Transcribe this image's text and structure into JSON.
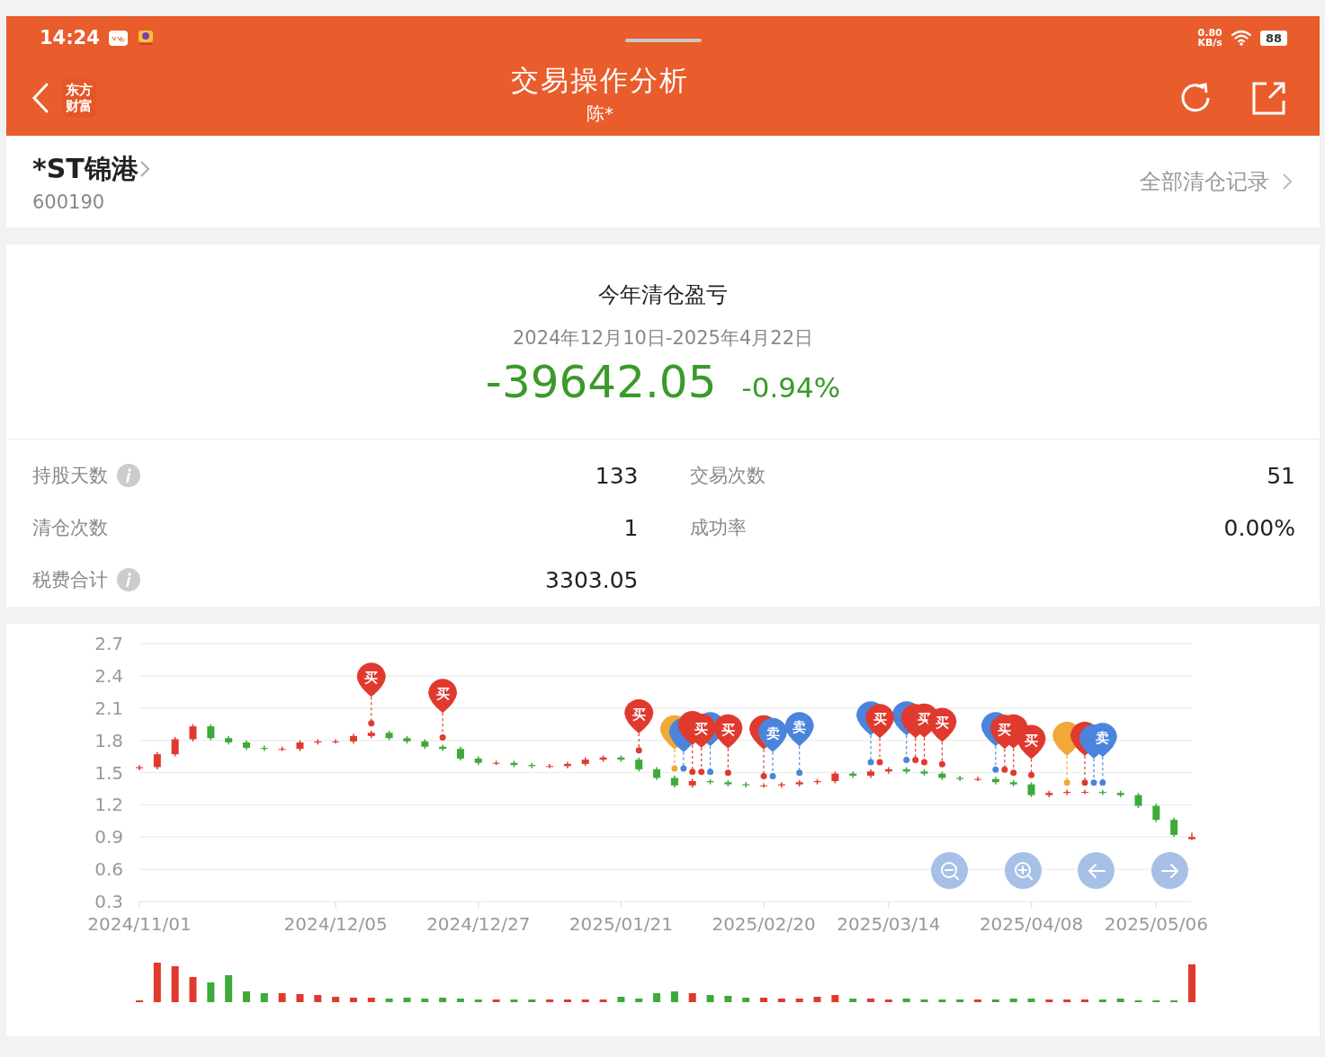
{
  "status_bar": {
    "time": "14:24",
    "network_speed": "0.80",
    "speed_unit": "KB/s",
    "battery": "88"
  },
  "header": {
    "logo": "东方财富",
    "title": "交易操作分析",
    "subtitle": "陈*"
  },
  "stock": {
    "name": "*ST锦港",
    "code": "600190",
    "link": "全部清仓记录"
  },
  "summary": {
    "title": "今年清仓盈亏",
    "period": "2024年12月10日-2025年4月22日",
    "profit": "-39642.05",
    "percent": "-0.94%"
  },
  "stats": [
    {
      "label": "持股天数",
      "value": "133",
      "info": true
    },
    {
      "label": "交易次数",
      "value": "51",
      "info": false
    },
    {
      "label": "清仓次数",
      "value": "1",
      "info": false
    },
    {
      "label": "成功率",
      "value": "0.00%",
      "info": false
    },
    {
      "label": "税费合计",
      "value": "3303.05",
      "info": true
    }
  ],
  "chart": {
    "chart_data": {
      "type": "candlestick",
      "categories": [
        "2024/11/01",
        null,
        null,
        null,
        null,
        null,
        null,
        null,
        null,
        null,
        null,
        "2024/12/05",
        null,
        null,
        null,
        null,
        null,
        null,
        null,
        "2024/12/27",
        null,
        null,
        null,
        null,
        null,
        null,
        null,
        "2025/01/21",
        null,
        null,
        null,
        null,
        null,
        null,
        null,
        "2025/02/20",
        null,
        null,
        null,
        null,
        null,
        null,
        "2025/03/14",
        null,
        null,
        null,
        null,
        null,
        null,
        null,
        "2025/04/08",
        null,
        null,
        null,
        null,
        null,
        null,
        "2025/05/06",
        null,
        null
      ],
      "ohlc": [
        [
          1.54,
          1.57,
          1.52,
          1.55
        ],
        [
          1.55,
          1.69,
          1.53,
          1.67
        ],
        [
          1.67,
          1.83,
          1.65,
          1.81
        ],
        [
          1.81,
          1.95,
          1.79,
          1.93
        ],
        [
          1.93,
          1.95,
          1.8,
          1.82
        ],
        [
          1.82,
          1.84,
          1.76,
          1.78
        ],
        [
          1.78,
          1.8,
          1.71,
          1.73
        ],
        [
          1.73,
          1.75,
          1.7,
          1.72
        ],
        [
          1.72,
          1.74,
          1.7,
          1.72
        ],
        [
          1.72,
          1.8,
          1.7,
          1.78
        ],
        [
          1.78,
          1.81,
          1.76,
          1.79
        ],
        [
          1.79,
          1.81,
          1.77,
          1.79
        ],
        [
          1.79,
          1.86,
          1.77,
          1.84
        ],
        [
          1.84,
          1.89,
          1.82,
          1.87
        ],
        [
          1.87,
          1.89,
          1.8,
          1.82
        ],
        [
          1.82,
          1.84,
          1.77,
          1.79
        ],
        [
          1.79,
          1.81,
          1.72,
          1.74
        ],
        [
          1.74,
          1.76,
          1.7,
          1.72
        ],
        [
          1.72,
          1.74,
          1.61,
          1.63
        ],
        [
          1.63,
          1.65,
          1.57,
          1.59
        ],
        [
          1.59,
          1.61,
          1.57,
          1.59
        ],
        [
          1.59,
          1.61,
          1.55,
          1.57
        ],
        [
          1.57,
          1.59,
          1.54,
          1.56
        ],
        [
          1.56,
          1.58,
          1.54,
          1.56
        ],
        [
          1.56,
          1.6,
          1.54,
          1.58
        ],
        [
          1.58,
          1.64,
          1.56,
          1.62
        ],
        [
          1.62,
          1.66,
          1.6,
          1.64
        ],
        [
          1.64,
          1.66,
          1.6,
          1.62
        ],
        [
          1.62,
          1.64,
          1.51,
          1.53
        ],
        [
          1.53,
          1.55,
          1.43,
          1.45
        ],
        [
          1.45,
          1.47,
          1.36,
          1.38
        ],
        [
          1.38,
          1.44,
          1.36,
          1.42
        ],
        [
          1.42,
          1.44,
          1.39,
          1.41
        ],
        [
          1.41,
          1.43,
          1.37,
          1.39
        ],
        [
          1.39,
          1.41,
          1.36,
          1.38
        ],
        [
          1.38,
          1.4,
          1.36,
          1.38
        ],
        [
          1.38,
          1.41,
          1.36,
          1.39
        ],
        [
          1.39,
          1.43,
          1.37,
          1.41
        ],
        [
          1.41,
          1.44,
          1.39,
          1.42
        ],
        [
          1.42,
          1.51,
          1.4,
          1.49
        ],
        [
          1.49,
          1.51,
          1.45,
          1.47
        ],
        [
          1.47,
          1.53,
          1.45,
          1.51
        ],
        [
          1.51,
          1.55,
          1.49,
          1.53
        ],
        [
          1.53,
          1.55,
          1.49,
          1.51
        ],
        [
          1.51,
          1.53,
          1.47,
          1.49
        ],
        [
          1.49,
          1.51,
          1.43,
          1.45
        ],
        [
          1.45,
          1.47,
          1.42,
          1.44
        ],
        [
          1.44,
          1.46,
          1.42,
          1.44
        ],
        [
          1.44,
          1.46,
          1.39,
          1.41
        ],
        [
          1.41,
          1.43,
          1.37,
          1.39
        ],
        [
          1.39,
          1.41,
          1.27,
          1.29
        ],
        [
          1.29,
          1.33,
          1.27,
          1.31
        ],
        [
          1.31,
          1.34,
          1.29,
          1.32
        ],
        [
          1.32,
          1.34,
          1.3,
          1.32
        ],
        [
          1.32,
          1.34,
          1.29,
          1.31
        ],
        [
          1.31,
          1.33,
          1.27,
          1.29
        ],
        [
          1.29,
          1.31,
          1.17,
          1.19
        ],
        [
          1.19,
          1.21,
          1.04,
          1.06
        ],
        [
          1.06,
          1.08,
          0.9,
          0.92
        ],
        [
          0.88,
          0.94,
          0.87,
          0.9
        ]
      ],
      "ylim": [
        0.3,
        2.7
      ],
      "grid": true,
      "yticks": [
        2.7,
        2.4,
        2.1,
        1.8,
        1.5,
        1.2,
        0.9,
        0.6,
        0.3
      ]
    },
    "markers": [
      {
        "kind": "buy",
        "text": "买"
      },
      {
        "kind": "buy",
        "text": "买"
      },
      {
        "kind": "buy",
        "text": "买"
      },
      {
        "kind": "other"
      },
      {
        "kind": "sell"
      },
      {
        "kind": "buy"
      },
      {
        "kind": "buy",
        "text": "买"
      },
      {
        "kind": "sell"
      },
      {
        "kind": "buy",
        "text": "买"
      },
      {
        "kind": "buy"
      },
      {
        "kind": "sell",
        "text": "卖"
      },
      {
        "kind": "sell",
        "text": "卖"
      },
      {
        "kind": "sell"
      },
      {
        "kind": "buy",
        "text": "买"
      },
      {
        "kind": "sell"
      },
      {
        "kind": "buy"
      },
      {
        "kind": "buy",
        "text": "买"
      },
      {
        "kind": "buy",
        "text": "买"
      },
      {
        "kind": "sell"
      },
      {
        "kind": "buy",
        "text": "买"
      },
      {
        "kind": "buy"
      },
      {
        "kind": "buy",
        "text": "买"
      },
      {
        "kind": "other"
      },
      {
        "kind": "buy"
      },
      {
        "kind": "sell"
      },
      {
        "kind": "sell",
        "text": "卖"
      }
    ]
  }
}
